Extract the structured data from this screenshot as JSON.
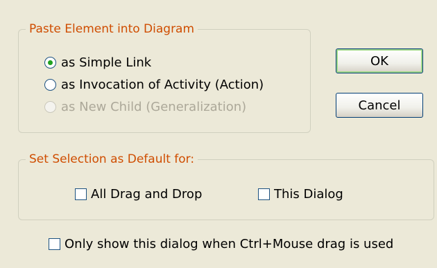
{
  "paste_group": {
    "legend": "Paste Element into Diagram",
    "options": [
      {
        "label": "as Simple Link",
        "checked": true,
        "enabled": true
      },
      {
        "label": "as Invocation of Activity (Action)",
        "checked": false,
        "enabled": true
      },
      {
        "label": "as New Child (Generalization)",
        "checked": false,
        "enabled": false
      }
    ]
  },
  "buttons": {
    "ok": "OK",
    "cancel": "Cancel"
  },
  "default_group": {
    "legend": "Set Selection as Default for:",
    "all_drag_drop": {
      "label": "All Drag and Drop",
      "checked": false
    },
    "this_dialog": {
      "label": "This Dialog",
      "checked": false
    }
  },
  "ctrl_option": {
    "label": "Only show this dialog when Ctrl+Mouse drag is used",
    "checked": false
  }
}
